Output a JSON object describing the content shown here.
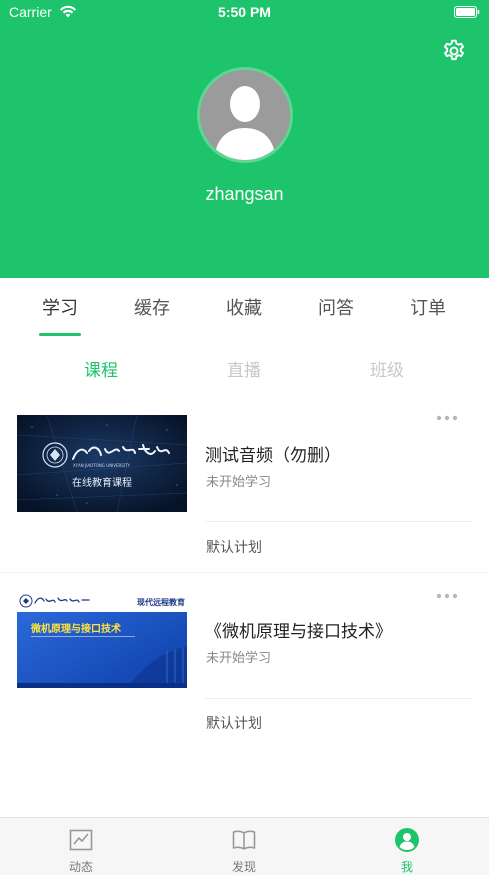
{
  "status_bar": {
    "carrier": "Carrier",
    "time": "5:50 PM"
  },
  "profile": {
    "username": "zhangsan"
  },
  "main_tabs": [
    {
      "label": "学习"
    },
    {
      "label": "缓存"
    },
    {
      "label": "收藏"
    },
    {
      "label": "问答"
    },
    {
      "label": "订单"
    }
  ],
  "sub_tabs": [
    {
      "label": "课程"
    },
    {
      "label": "直播"
    },
    {
      "label": "班级"
    }
  ],
  "courses": [
    {
      "title": "测试音频（勿删）",
      "status": "未开始学习",
      "plan": "默认计划",
      "thumb_text": "在线教育课程",
      "thumb_caption": "XI'AN JIAOTONG UNIVERSITY"
    },
    {
      "title": "《微机原理与接口技术》",
      "status": "未开始学习",
      "plan": "默认计划",
      "thumb_text": "微机原理与接口技术",
      "thumb_tag": "现代远程教育"
    }
  ],
  "tab_bar": [
    {
      "label": "动态"
    },
    {
      "label": "发现"
    },
    {
      "label": "我"
    }
  ],
  "colors": {
    "accent": "#1ec46b",
    "header_bg": "#1ec46b"
  }
}
